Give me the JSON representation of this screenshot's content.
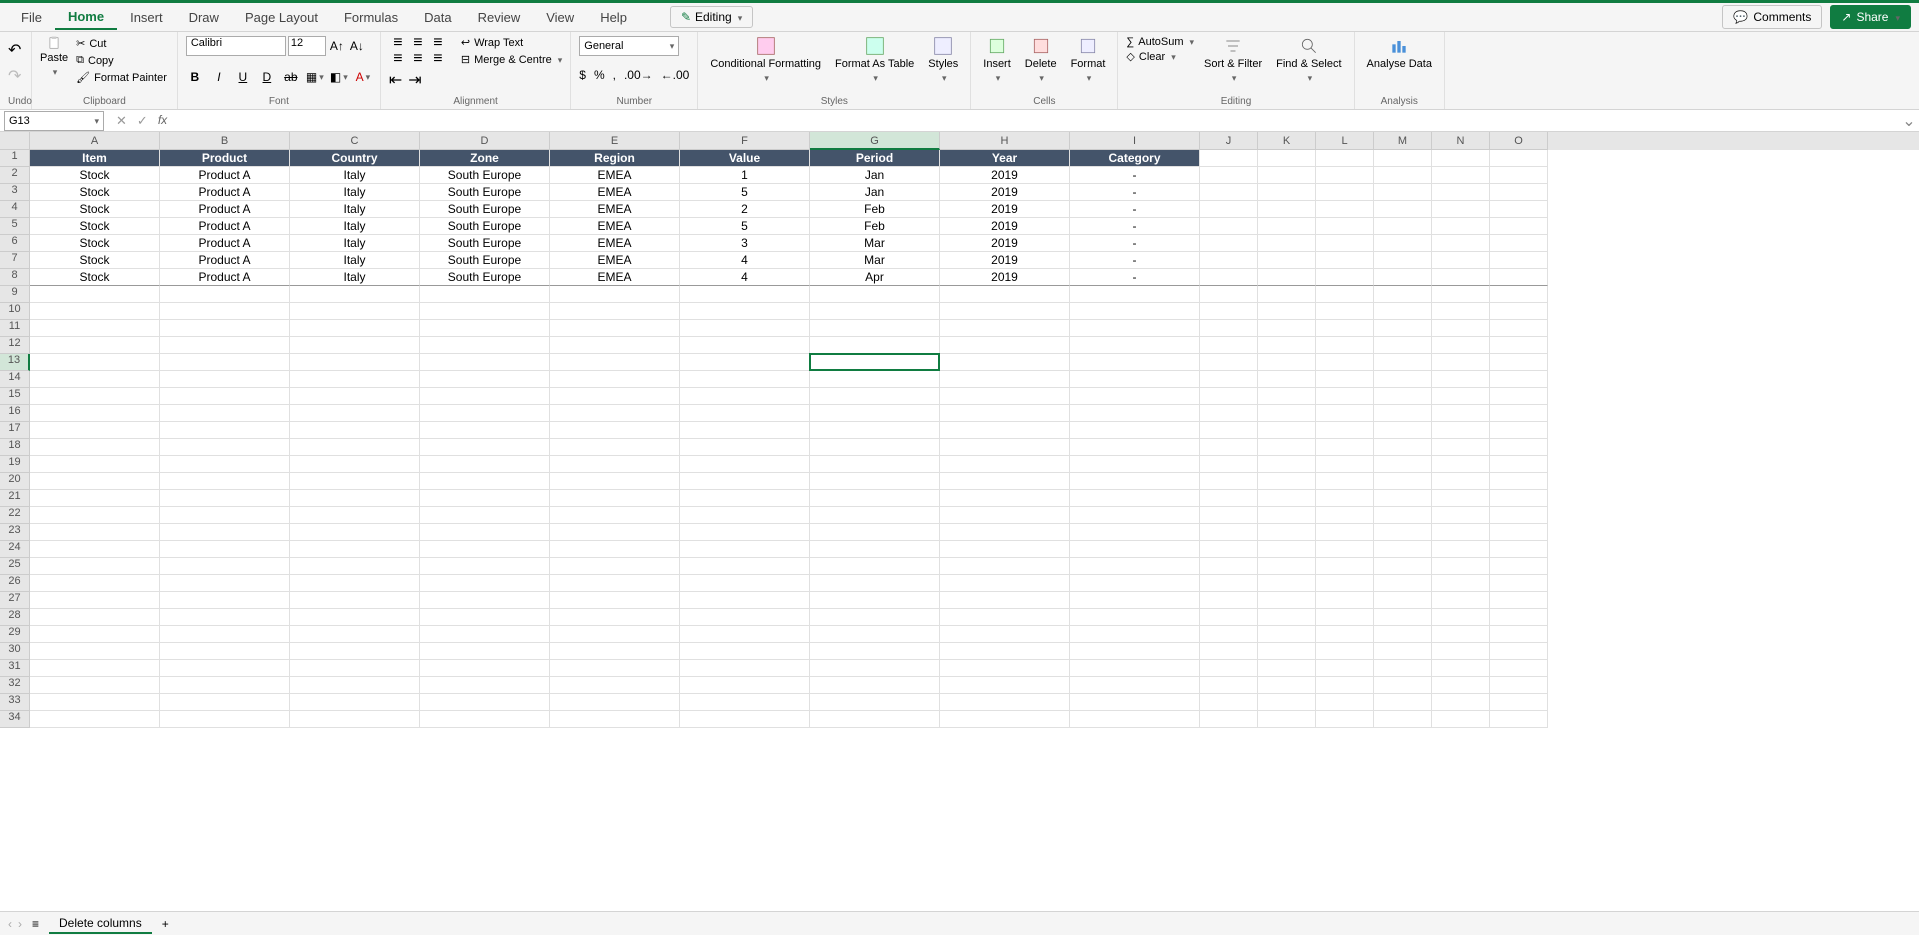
{
  "menu": {
    "items": [
      "File",
      "Home",
      "Insert",
      "Draw",
      "Page Layout",
      "Formulas",
      "Data",
      "Review",
      "View",
      "Help"
    ],
    "active": "Home",
    "editing": "Editing",
    "comments": "Comments",
    "share": "Share"
  },
  "ribbon": {
    "undo_label": "Undo",
    "clipboard": {
      "paste": "Paste",
      "cut": "Cut",
      "copy": "Copy",
      "painter": "Format Painter",
      "label": "Clipboard"
    },
    "font": {
      "name": "Calibri",
      "size": "12",
      "label": "Font"
    },
    "alignment": {
      "wrap": "Wrap Text",
      "merge": "Merge & Centre",
      "label": "Alignment"
    },
    "number": {
      "format": "General",
      "label": "Number"
    },
    "styles": {
      "cond": "Conditional Formatting",
      "fat": "Format As Table",
      "styles": "Styles",
      "label": "Styles"
    },
    "cells": {
      "insert": "Insert",
      "delete": "Delete",
      "format": "Format",
      "label": "Cells"
    },
    "editing": {
      "autosum": "AutoSum",
      "clear": "Clear",
      "sort": "Sort & Filter",
      "find": "Find & Select",
      "label": "Editing"
    },
    "analysis": {
      "analyse": "Analyse Data",
      "label": "Analysis"
    }
  },
  "namebox": "G13",
  "formula": "",
  "columns": {
    "letters": [
      "A",
      "B",
      "C",
      "D",
      "E",
      "F",
      "G",
      "H",
      "I",
      "J",
      "K",
      "L",
      "M",
      "N",
      "O"
    ],
    "widths": [
      130,
      130,
      130,
      130,
      130,
      130,
      130,
      130,
      130,
      58,
      58,
      58,
      58,
      58,
      58
    ],
    "selected": 6
  },
  "selected_row": 13,
  "table": {
    "headers": [
      "Item",
      "Product",
      "Country",
      "Zone",
      "Region",
      "Value",
      "Period",
      "Year",
      "Category"
    ],
    "rows": [
      [
        "Stock",
        "Product A",
        "Italy",
        "South Europe",
        "EMEA",
        "1",
        "Jan",
        "2019",
        "-"
      ],
      [
        "Stock",
        "Product A",
        "Italy",
        "South Europe",
        "EMEA",
        "5",
        "Jan",
        "2019",
        "-"
      ],
      [
        "Stock",
        "Product A",
        "Italy",
        "South Europe",
        "EMEA",
        "2",
        "Feb",
        "2019",
        "-"
      ],
      [
        "Stock",
        "Product A",
        "Italy",
        "South Europe",
        "EMEA",
        "5",
        "Feb",
        "2019",
        "-"
      ],
      [
        "Stock",
        "Product A",
        "Italy",
        "South Europe",
        "EMEA",
        "3",
        "Mar",
        "2019",
        "-"
      ],
      [
        "Stock",
        "Product A",
        "Italy",
        "South Europe",
        "EMEA",
        "4",
        "Mar",
        "2019",
        "-"
      ],
      [
        "Stock",
        "Product A",
        "Italy",
        "South Europe",
        "EMEA",
        "4",
        "Apr",
        "2019",
        "-"
      ]
    ]
  },
  "total_rows": 34,
  "sheet_tab": "Delete columns",
  "selection": {
    "col": 6,
    "row": 13
  }
}
